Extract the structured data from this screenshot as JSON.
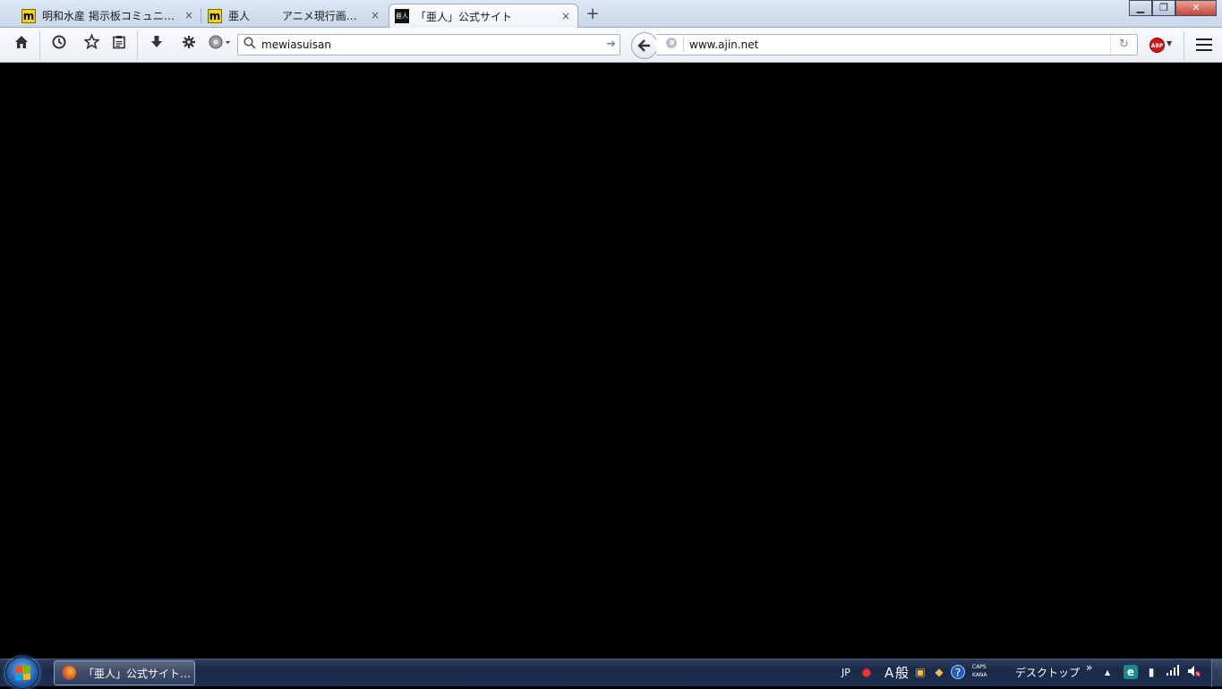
{
  "tabs": [
    {
      "title": "明和水産 掲示板コミュニ…",
      "favicon_letter": "m",
      "active": false
    },
    {
      "title": "亜人",
      "favicon_letter": "m",
      "active": false
    },
    {
      "title": "アニメ現行画…",
      "active": false
    },
    {
      "title": "「亜人」公式サイト",
      "favicon_text": "亜人",
      "active": true
    }
  ],
  "tab_close_glyph": "×",
  "new_tab_glyph": "+",
  "window_controls": {
    "minimize": "▁",
    "maximize": "❐",
    "close": "✕"
  },
  "toolbar": {
    "icons": [
      "home-icon",
      "history-icon",
      "bookmark-star-icon",
      "reading-list-icon",
      "download-icon",
      "settings-gear-icon",
      "sync-account-icon"
    ],
    "search_value": "mewiasuisan",
    "url_value": "www.ajin.net",
    "adblock_label": "ABP"
  },
  "taskbar": {
    "window_button_label": "「亜人」公式サイト…",
    "tray": {
      "language": "JP",
      "ime_mode": "A",
      "ime_conversion": "般",
      "caps_label": "CAPS",
      "kana_label": "KANA",
      "desktop_label": "デスクトップ",
      "expand_glyph": "»",
      "tray_arrow": "▲"
    }
  },
  "colors": {
    "content_background": "#000000",
    "taskbar": "#1a2947",
    "tabstrip": "#c7d6ea",
    "adblock_red": "#d01818"
  }
}
